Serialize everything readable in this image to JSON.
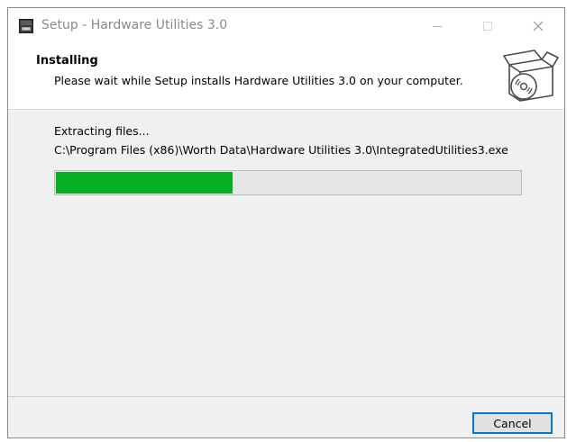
{
  "window": {
    "title": "Setup - Hardware Utilities 3.0"
  },
  "header": {
    "title": "Installing",
    "subtitle": "Please wait while Setup installs Hardware Utilities 3.0 on your computer.",
    "icon": "software-box-cd-icon"
  },
  "progress": {
    "status": "Extracting files...",
    "current_file": "C:\\Program Files (x86)\\Worth Data\\Hardware Utilities 3.0\\IntegratedUtilities3.exe",
    "fraction": 0.38,
    "fill_color": "#06b025"
  },
  "footer": {
    "cancel_label": "Cancel"
  },
  "colors": {
    "accent": "#0078d7",
    "progress_green": "#06b025"
  }
}
